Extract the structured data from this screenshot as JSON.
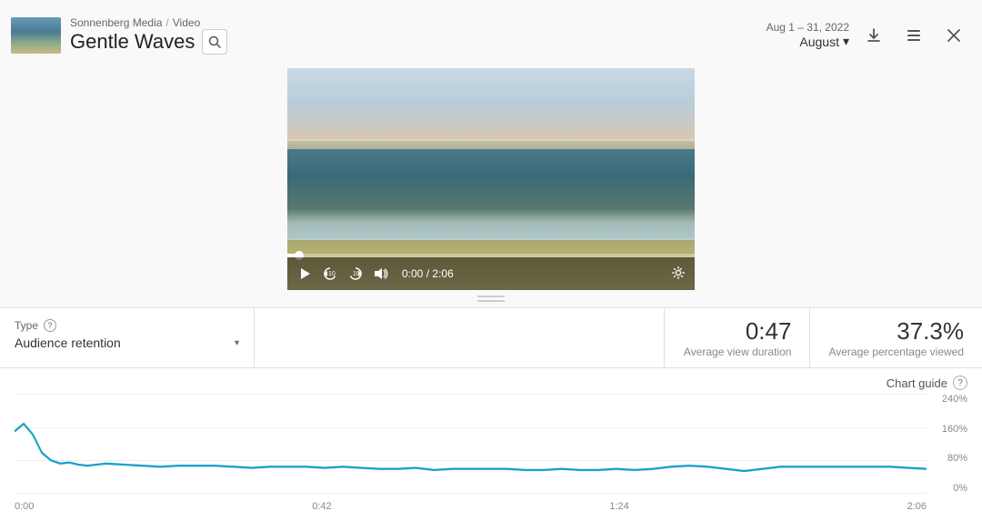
{
  "header": {
    "breadcrumb_parent": "Sonnenberg Media",
    "breadcrumb_separator": "/",
    "breadcrumb_child": "Video",
    "title": "Gentle Waves",
    "search_placeholder": "Search",
    "date_range": "Aug 1 – 31, 2022",
    "month_label": "August"
  },
  "video": {
    "current_time": "0:00",
    "separator": "/",
    "total_time": "2:06"
  },
  "type_selector": {
    "label": "Type",
    "value": "Audience retention"
  },
  "stats": {
    "avg_view_duration": "0:47",
    "avg_view_duration_label": "Average view duration",
    "avg_pct_viewed": "37.3%",
    "avg_pct_viewed_label": "Average percentage viewed"
  },
  "chart": {
    "guide_label": "Chart guide",
    "y_labels": [
      "240%",
      "160%",
      "80%",
      "0%"
    ],
    "x_labels": [
      "0:00",
      "0:42",
      "1:24",
      "2:06"
    ]
  },
  "icons": {
    "download": "⬇",
    "more": "⋮",
    "close": "✕",
    "search": "🔍",
    "play": "▶",
    "rewind": "↺",
    "forward": "↻",
    "volume": "🔊",
    "settings": "⚙",
    "chevron_down": "▾",
    "help": "?",
    "drag": "≡"
  }
}
